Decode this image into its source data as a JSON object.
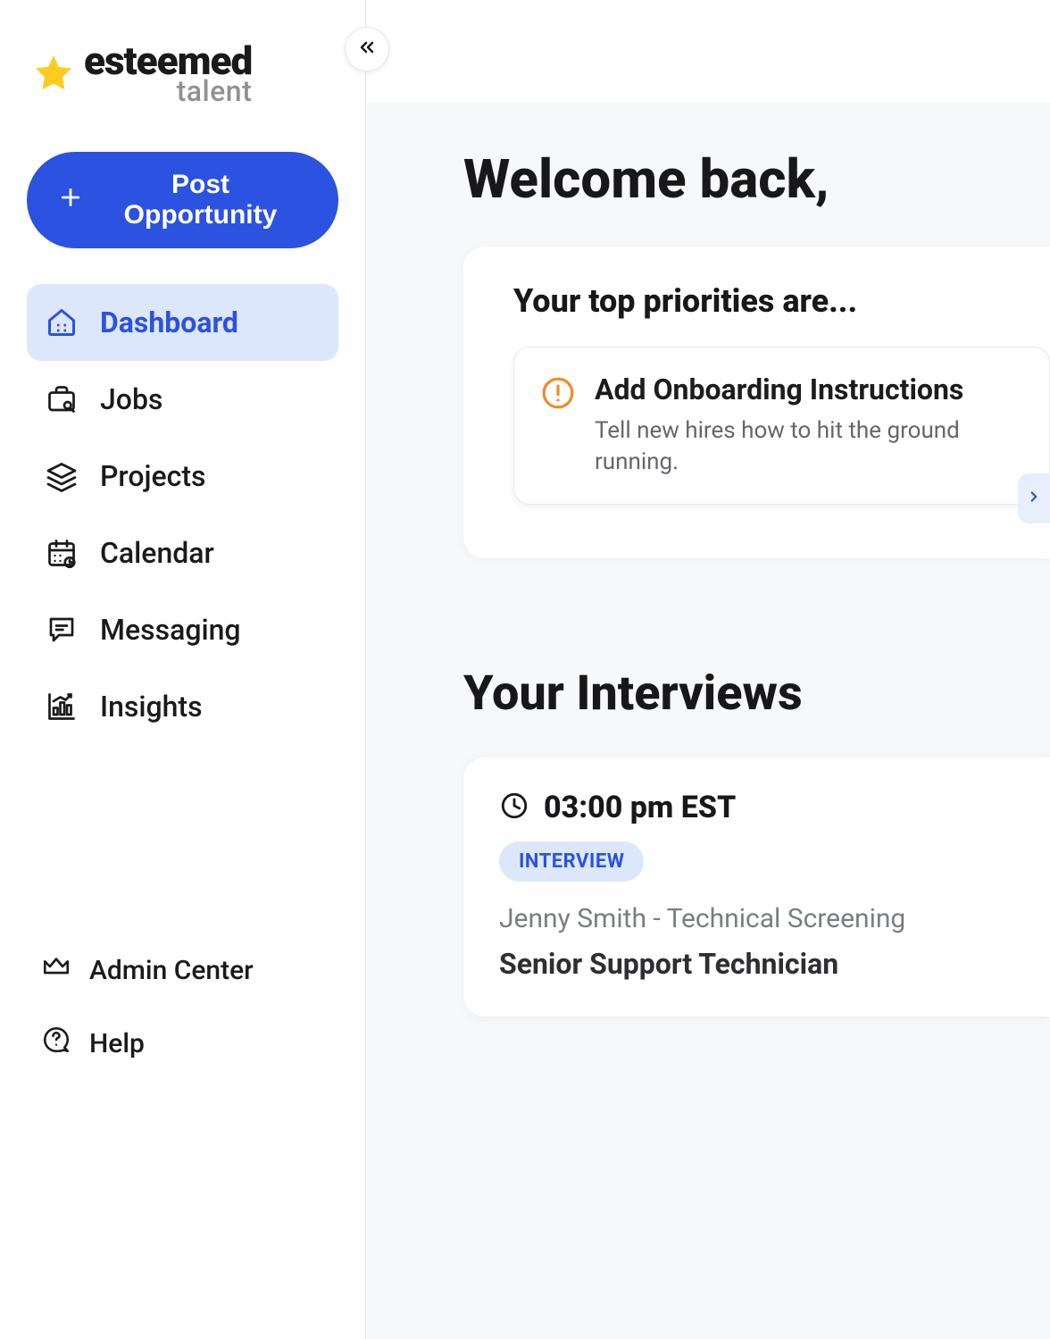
{
  "brand": {
    "name": "esteemed",
    "sub": "talent"
  },
  "sidebar": {
    "postButton": "Post Opportunity",
    "items": [
      {
        "label": "Dashboard"
      },
      {
        "label": "Jobs"
      },
      {
        "label": "Projects"
      },
      {
        "label": "Calendar"
      },
      {
        "label": "Messaging"
      },
      {
        "label": "Insights"
      }
    ],
    "bottom": [
      {
        "label": "Admin Center"
      },
      {
        "label": "Help"
      }
    ]
  },
  "main": {
    "title": "Welcome back,",
    "priorities": {
      "heading": "Your top priorities are...",
      "item": {
        "title": "Add Onboarding Instructions",
        "desc": "Tell new hires how to hit the ground running."
      }
    },
    "interviews": {
      "heading": "Your Interviews",
      "card": {
        "time": "03:00 pm EST",
        "badge": "INTERVIEW",
        "person": "Jenny Smith - Technical Screening",
        "role": "Senior Support Technician"
      }
    }
  }
}
